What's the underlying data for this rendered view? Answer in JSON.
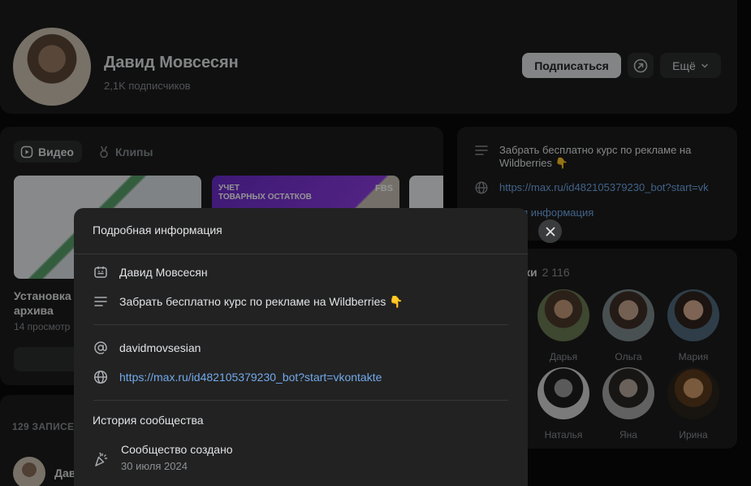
{
  "profile": {
    "name": "Давид Мовсесян",
    "subscribers": "2,1K подписчиков",
    "subscribe_label": "Подписаться",
    "more_label": "Ещё"
  },
  "video_section": {
    "tabs": [
      {
        "label": "Видео",
        "icon": "video-icon"
      },
      {
        "label": "Клипы",
        "icon": "clips-icon"
      }
    ],
    "thumb2_text": "УЧЕТ\nТОВАРНЫХ ОСТАТКОВ",
    "thumb2_badge": "FBS",
    "first_video_title": "Установка\nархива",
    "first_video_meta": "14 просмотр"
  },
  "posts": {
    "count_label": "129 ЗАПИСЕ",
    "first_author": "Дав"
  },
  "info_panel": {
    "description": "Забрать бесплатно курс по рекламе на Wildberries 👇",
    "link": "https://max.ru/id482105379230_bot?start=vk",
    "more_label": "обная информация"
  },
  "followers": {
    "title": "ки",
    "count": "2 116",
    "items": [
      {
        "name": "Дарья"
      },
      {
        "name": "Ольга"
      },
      {
        "name": "Мария"
      },
      {
        "name": "Наталья"
      },
      {
        "name": "Яна"
      },
      {
        "name": "Ирина"
      }
    ]
  },
  "modal": {
    "title": "Подробная информация",
    "name": "Давид Мовсесян",
    "description": "Забрать бесплатно курс по рекламе на Wildberries 👇",
    "username": "davidmovsesian",
    "link": "https://max.ru/id482105379230_bot?start=vkontakte",
    "history_title": "История сообщества",
    "history_event": "Сообщество создано",
    "history_date": "30 июля 2024"
  },
  "colors": {
    "background": "#0a0a0a",
    "card": "#1c1c1c",
    "modal": "#222222",
    "link": "#71aaeb",
    "text_primary": "#e1e3e6",
    "text_secondary": "#8b8f94"
  }
}
